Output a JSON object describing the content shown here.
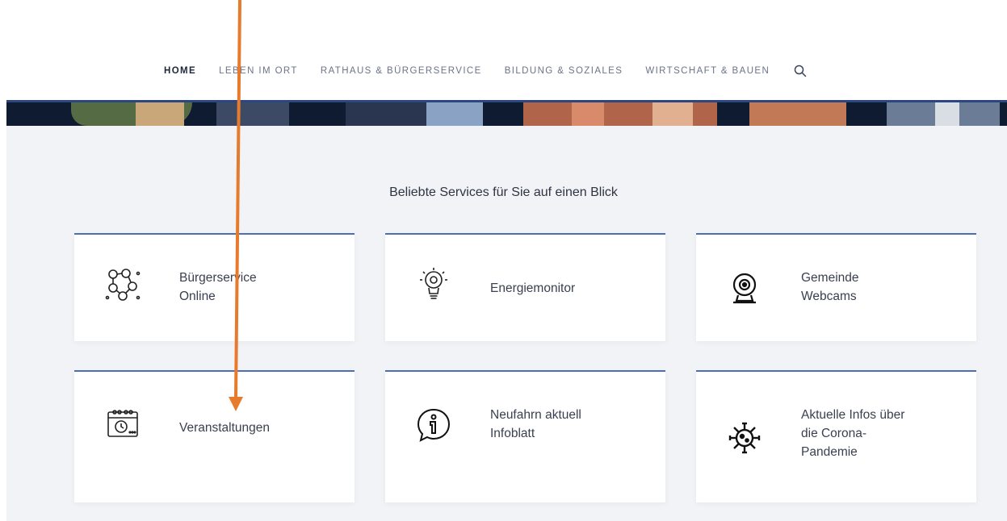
{
  "nav": {
    "items": [
      {
        "label": "HOME",
        "active": true
      },
      {
        "label": "LEBEN IM ORT",
        "active": false
      },
      {
        "label": "RATHAUS & BÜRGERSERVICE",
        "active": false
      },
      {
        "label": "BILDUNG & SOZIALES",
        "active": false
      },
      {
        "label": "WIRTSCHAFT & BAUEN",
        "active": false
      }
    ],
    "search_icon": "search-icon"
  },
  "services": {
    "title": "Beliebte Services für Sie auf einen Blick",
    "cards": [
      {
        "label": "Bürgerservice\nOnline",
        "icon": "people-network-icon"
      },
      {
        "label": "Energiemonitor",
        "icon": "lightbulb-gear-icon"
      },
      {
        "label": "Gemeinde\nWebcams",
        "icon": "webcam-icon"
      },
      {
        "label": "Veranstaltungen",
        "icon": "calendar-clock-icon"
      },
      {
        "label": "Neufahrn aktuell\nInfoblatt",
        "icon": "info-bubble-icon"
      },
      {
        "label": "Aktuelle Infos über\ndie Corona-\nPandemie",
        "icon": "virus-icon"
      }
    ]
  },
  "colors": {
    "accent": "#4a6fb5",
    "nav_text": "#6b7388",
    "section_bg": "#f2f3f7",
    "annotation_arrow": "#e87a2c"
  }
}
